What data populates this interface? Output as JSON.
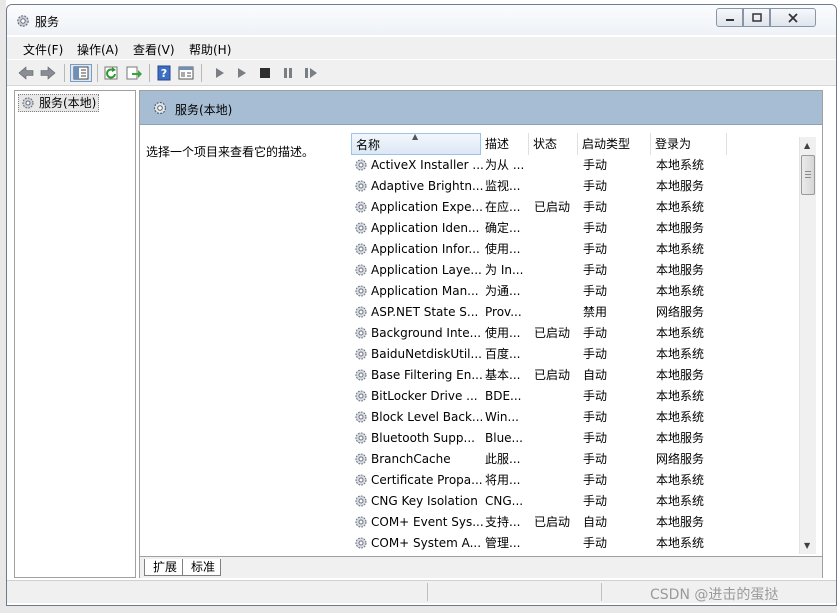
{
  "window": {
    "title": "服务",
    "icon": "gear-icon",
    "controls": [
      "minimize-icon",
      "maximize-icon",
      "close-icon"
    ]
  },
  "menu": [
    "文件(F)",
    "操作(A)",
    "查看(V)",
    "帮助(H)"
  ],
  "toolbar": {
    "icons": [
      "back-arrow-icon",
      "forward-arrow-icon",
      "show-hide-tree-icon",
      "refresh-icon",
      "export-list-icon",
      "help-icon",
      "properties-icon",
      "start-service-icon",
      "start-service-icon-2",
      "stop-service-icon",
      "pause-service-icon",
      "resume-service-icon"
    ]
  },
  "tree": {
    "root_label": "服务(本地)"
  },
  "details": {
    "header": "服务(本地)",
    "description_prompt": "选择一个项目来查看它的描述。",
    "columns": [
      "名称",
      "描述",
      "状态",
      "启动类型",
      "登录为"
    ],
    "rows": [
      {
        "name": "ActiveX Installer ...",
        "desc": "为从 ...",
        "status": "",
        "start": "手动",
        "logon": "本地系统"
      },
      {
        "name": "Adaptive Brightn...",
        "desc": "监视...",
        "status": "",
        "start": "手动",
        "logon": "本地服务"
      },
      {
        "name": "Application Expe...",
        "desc": "在应...",
        "status": "已启动",
        "start": "手动",
        "logon": "本地系统"
      },
      {
        "name": "Application Iden...",
        "desc": "确定...",
        "status": "",
        "start": "手动",
        "logon": "本地服务"
      },
      {
        "name": "Application Infor...",
        "desc": "使用...",
        "status": "",
        "start": "手动",
        "logon": "本地系统"
      },
      {
        "name": "Application Laye...",
        "desc": "为 In...",
        "status": "",
        "start": "手动",
        "logon": "本地服务"
      },
      {
        "name": "Application Man...",
        "desc": "为通...",
        "status": "",
        "start": "手动",
        "logon": "本地系统"
      },
      {
        "name": "ASP.NET State S...",
        "desc": "Prov...",
        "status": "",
        "start": "禁用",
        "logon": "网络服务"
      },
      {
        "name": "Background Inte...",
        "desc": "使用...",
        "status": "已启动",
        "start": "手动",
        "logon": "本地系统"
      },
      {
        "name": "BaiduNetdiskUtil...",
        "desc": "百度...",
        "status": "",
        "start": "手动",
        "logon": "本地系统"
      },
      {
        "name": "Base Filtering En...",
        "desc": "基本...",
        "status": "已启动",
        "start": "自动",
        "logon": "本地服务"
      },
      {
        "name": "BitLocker Drive ...",
        "desc": "BDE...",
        "status": "",
        "start": "手动",
        "logon": "本地系统"
      },
      {
        "name": "Block Level Back...",
        "desc": "Win...",
        "status": "",
        "start": "手动",
        "logon": "本地系统"
      },
      {
        "name": "Bluetooth Supp...",
        "desc": "Blue...",
        "status": "",
        "start": "手动",
        "logon": "本地服务"
      },
      {
        "name": "BranchCache",
        "desc": "此服...",
        "status": "",
        "start": "手动",
        "logon": "网络服务"
      },
      {
        "name": "Certificate Propa...",
        "desc": "将用...",
        "status": "",
        "start": "手动",
        "logon": "本地系统"
      },
      {
        "name": "CNG Key Isolation",
        "desc": "CNG...",
        "status": "",
        "start": "手动",
        "logon": "本地系统"
      },
      {
        "name": "COM+ Event Sys...",
        "desc": "支持...",
        "status": "已启动",
        "start": "自动",
        "logon": "本地服务"
      },
      {
        "name": "COM+ System A...",
        "desc": "管理...",
        "status": "",
        "start": "手动",
        "logon": "本地系统"
      }
    ]
  },
  "tabs": [
    "扩展",
    "标准"
  ],
  "watermark": "CSDN @进击的蛋挞"
}
